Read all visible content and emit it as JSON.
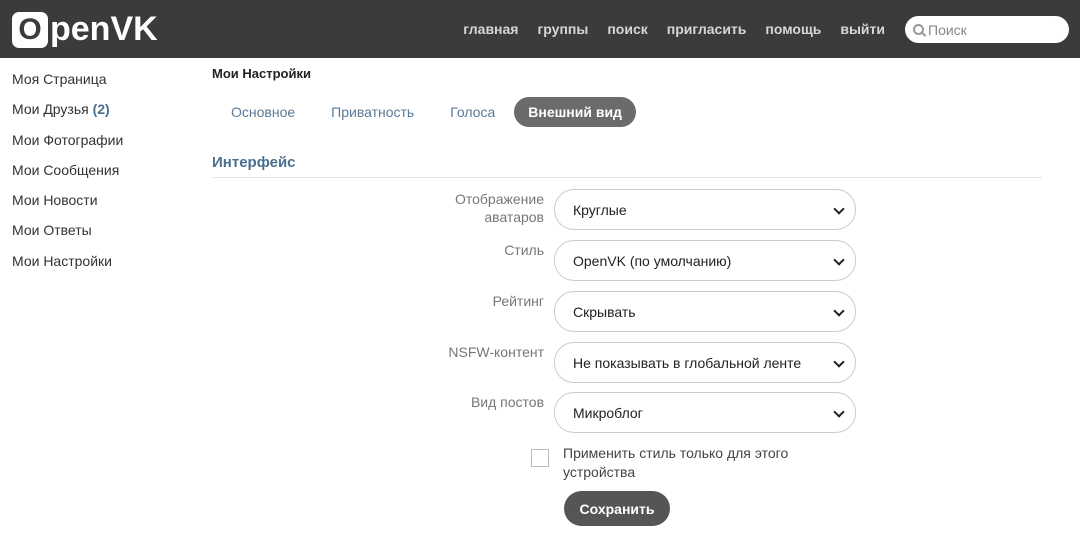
{
  "header": {
    "logo": "penVK",
    "logo_letter": "O",
    "nav": [
      "главная",
      "группы",
      "поиск",
      "пригласить",
      "помощь",
      "выйти"
    ],
    "search_placeholder": "Поиск"
  },
  "sidebar": {
    "items": [
      {
        "label": "Моя Страница"
      },
      {
        "label": "Мои Друзья ",
        "count": "(2)"
      },
      {
        "label": "Мои Фотографии"
      },
      {
        "label": "Мои Сообщения"
      },
      {
        "label": "Мои Новости"
      },
      {
        "label": "Мои Ответы"
      },
      {
        "label": "Мои Настройки"
      }
    ]
  },
  "main": {
    "title": "Мои Настройки",
    "tabs": [
      "Основное",
      "Приватность",
      "Голоса",
      "Внешний вид"
    ],
    "section": "Интерфейс",
    "fields": [
      {
        "label": "Отображение аватаров",
        "value": "Круглые"
      },
      {
        "label": "Стиль",
        "value": "OpenVK (по умолчанию)"
      },
      {
        "label": "Рейтинг",
        "value": "Скрывать"
      },
      {
        "label": "NSFW-контент",
        "value": "Не показывать в глобальной ленте"
      },
      {
        "label": "Вид постов",
        "value": "Микроблог"
      }
    ],
    "checkbox_label": "Применить стиль только для этого устройства",
    "save": "Сохранить"
  }
}
